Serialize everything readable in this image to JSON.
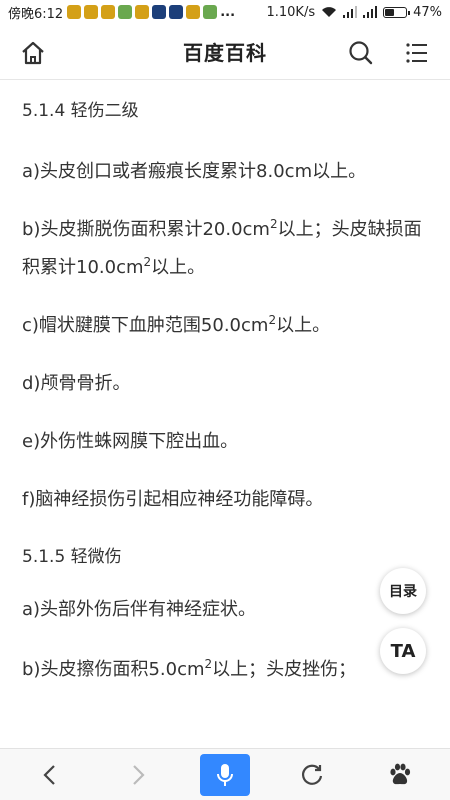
{
  "status_bar": {
    "time": "傍晚6:12",
    "more": "...",
    "network_speed": "1.10K/s",
    "battery_percent": "47%",
    "battery_level": 0.47,
    "app_icon_colors": [
      "#d4a017",
      "#d4a017",
      "#d4a017",
      "#6aa84f",
      "#d4a017",
      "#1c3f7a",
      "#1c3f7a",
      "#d4a017",
      "#6aa84f"
    ]
  },
  "header": {
    "title": "百度百科",
    "home_icon": "home-icon",
    "search_icon": "search-icon",
    "menu_icon": "menu-icon"
  },
  "content": {
    "section1_heading": "5.1.4 轻伤二级",
    "item_a": "a)头皮创口或者瘢痕长度累计8.0cm以上。",
    "item_b_part1": "b)头皮撕脱伤面积累计20.0cm",
    "item_b_sup1": "2",
    "item_b_part2": "以上；头皮缺损面积累计10.0cm",
    "item_b_sup2": "2",
    "item_b_part3": "以上。",
    "item_c_part1": "c)帽状腱膜下血肿范围50.0cm",
    "item_c_sup": "2",
    "item_c_part2": "以上。",
    "item_d": "d)颅骨骨折。",
    "item_e": "e)外伤性蛛网膜下腔出血。",
    "item_f": "f)脑神经损伤引起相应神经功能障碍。",
    "section2_heading": "5.1.5 轻微伤",
    "item2_a": "a)头部外伤后伴有神经症状。",
    "item2_b_part1": "b)头皮擦伤面积5.0cm",
    "item2_b_sup": "2",
    "item2_b_part2": "以上；头皮挫伤；"
  },
  "floating": {
    "toc_label": "目录",
    "ta_label": "TA"
  },
  "bottom_nav": {
    "back_icon": "back-icon",
    "forward_icon": "forward-icon",
    "voice_icon": "microphone-icon",
    "refresh_icon": "refresh-icon",
    "baidu_icon": "baidu-paw-icon",
    "accent_color": "#3388ff"
  }
}
